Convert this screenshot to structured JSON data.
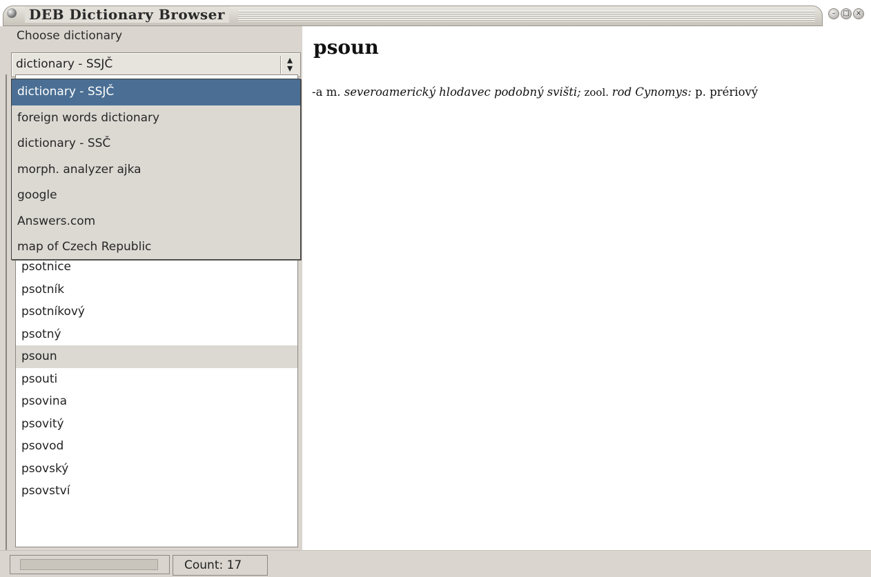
{
  "window": {
    "title": "DEB Dictionary Browser",
    "buttons": [
      "minimize",
      "maximize",
      "close"
    ]
  },
  "left_panel": {
    "choose_label": "Choose dictionary",
    "combo_value": "dictionary - SSJČ",
    "dropdown_options": [
      "dictionary - SSJČ",
      "foreign words dictionary",
      "dictionary - SSČ",
      "morph. analyzer ajka",
      "google",
      "Answers.com",
      "map of Czech Republic"
    ],
    "active_option_index": 0,
    "word_list": [
      "psotnice",
      "psotník",
      "psotníkový",
      "psotný",
      "psoun",
      "psouti",
      "psovina",
      "psovitý",
      "psovod",
      "psovský",
      "psovství"
    ],
    "selected_word": "psoun"
  },
  "entry": {
    "headword": "psoun",
    "definition": {
      "part1": "-a m. ",
      "part2": "severoamerický hlodavec podobný svišti;",
      "part3": " zool. ",
      "part4": "rod Cynomys:",
      "part5": " p. prériový"
    }
  },
  "status": {
    "progress": 0,
    "count_text": "Count: 17"
  },
  "colors": {
    "selection": "#4b6f94",
    "panel": "#dad6cf"
  }
}
